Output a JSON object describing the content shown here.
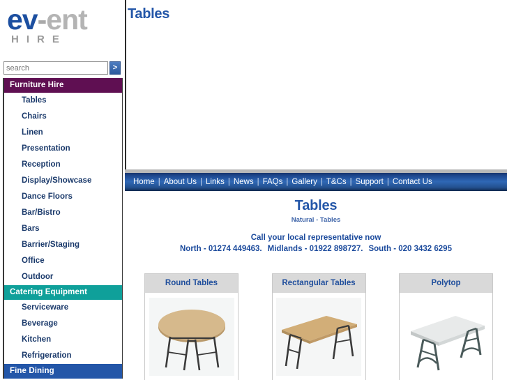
{
  "brand": {
    "logo_part1": "ev",
    "logo_dash": "-",
    "logo_part2": "ent",
    "logo_subtitle": "HIRE",
    "color_primary": "#1c4fa0",
    "color_grey": "#b4b4b4"
  },
  "search": {
    "placeholder": "search",
    "value": "",
    "button_label": ">"
  },
  "sidebar": {
    "sections": [
      {
        "header": "Furniture Hire",
        "color": "#5f0f52",
        "items": [
          {
            "label": "Tables"
          },
          {
            "label": "Chairs"
          },
          {
            "label": "Linen"
          },
          {
            "label": "Presentation"
          },
          {
            "label": "Reception"
          },
          {
            "label": "Display/Showcase"
          },
          {
            "label": "Dance Floors"
          },
          {
            "label": "Bar/Bistro"
          },
          {
            "label": "Bars"
          },
          {
            "label": "Barrier/Staging"
          },
          {
            "label": "Office"
          },
          {
            "label": "Outdoor"
          }
        ]
      },
      {
        "header": "Catering Equipment",
        "color": "#0fa09a",
        "items": [
          {
            "label": "Serviceware"
          },
          {
            "label": "Beverage"
          },
          {
            "label": "Kitchen"
          },
          {
            "label": "Refrigeration"
          }
        ]
      },
      {
        "header": "Fine Dining",
        "color": "#2356a8",
        "items": []
      }
    ]
  },
  "header": {
    "page_title": "Tables"
  },
  "nav": {
    "separator": "|",
    "items": [
      {
        "label": "Home"
      },
      {
        "label": "About Us"
      },
      {
        "label": "Links"
      },
      {
        "label": "News"
      },
      {
        "label": "FAQs"
      },
      {
        "label": "Gallery"
      },
      {
        "label": "T&Cs"
      },
      {
        "label": "Support"
      },
      {
        "label": "Contact Us"
      }
    ]
  },
  "main": {
    "title": "Tables",
    "breadcrumb": "Natural - Tables",
    "call_heading": "Call your local representative now",
    "phones": {
      "north": "North - 01274 449463.",
      "midlands": "Midlands - 01922 898727.",
      "south": "South - 020 3432 6295"
    },
    "cards": [
      {
        "title": "Round Tables",
        "image": "round-table-image"
      },
      {
        "title": "Rectangular Tables",
        "image": "rectangular-table-image"
      },
      {
        "title": "Polytop",
        "image": "polytop-table-image"
      }
    ]
  }
}
